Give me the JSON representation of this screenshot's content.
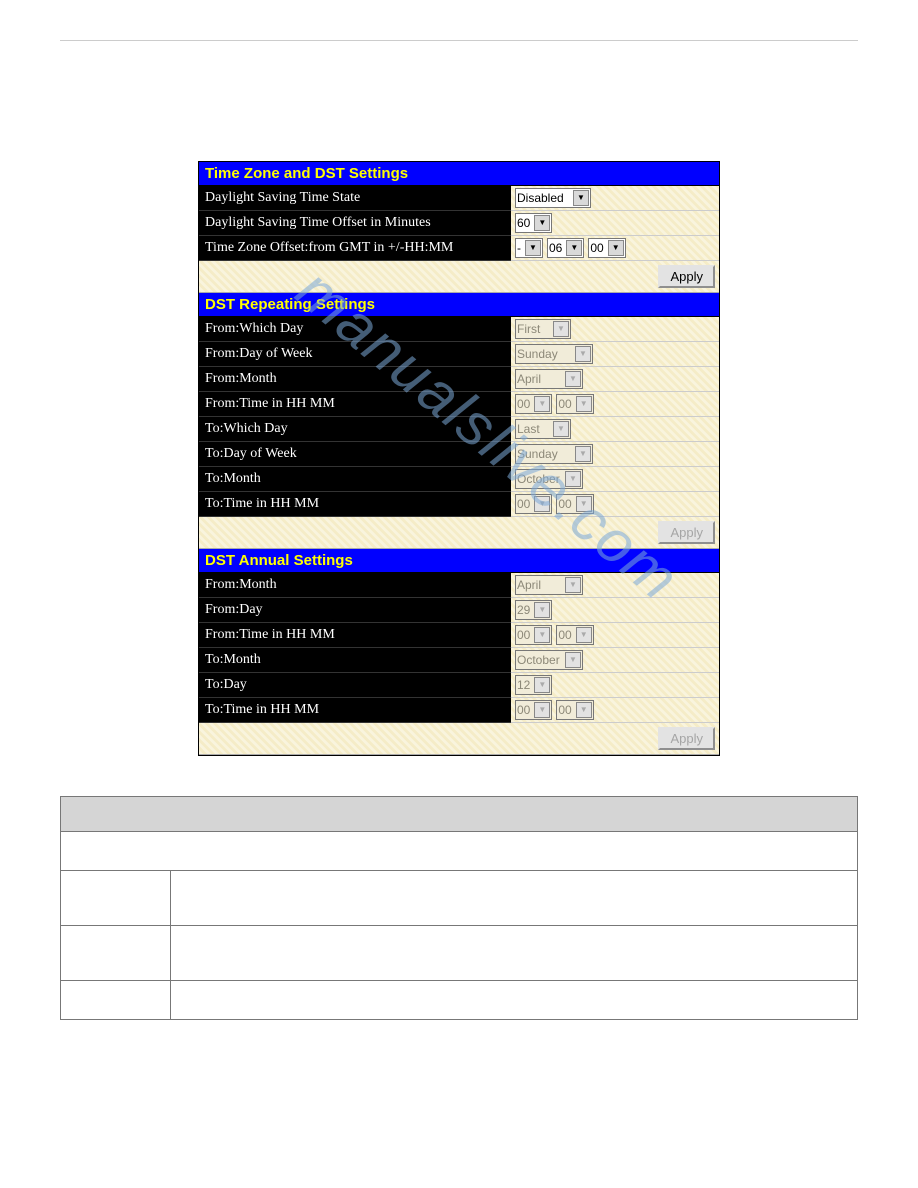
{
  "watermark": "manualslive.com",
  "sections": {
    "tz": "Time Zone and DST Settings",
    "repeating": "DST Repeating Settings",
    "annual": "DST Annual Settings"
  },
  "rows": {
    "dst_state": {
      "label": "Daylight Saving Time State",
      "value": "Disabled"
    },
    "dst_offset": {
      "label": "Daylight Saving Time Offset in Minutes",
      "value": "60"
    },
    "tz_offset": {
      "label": "Time Zone Offset:from GMT in +/-HH:MM",
      "sign": "-",
      "hh": "06",
      "mm": "00"
    },
    "rep_from_which": {
      "label": "From:Which Day",
      "value": "First"
    },
    "rep_from_dow": {
      "label": "From:Day of Week",
      "value": "Sunday"
    },
    "rep_from_month": {
      "label": "From:Month",
      "value": "April"
    },
    "rep_from_time": {
      "label": "From:Time in HH MM",
      "hh": "00",
      "mm": "00"
    },
    "rep_to_which": {
      "label": "To:Which Day",
      "value": "Last"
    },
    "rep_to_dow": {
      "label": "To:Day of Week",
      "value": "Sunday"
    },
    "rep_to_month": {
      "label": "To:Month",
      "value": "October"
    },
    "rep_to_time": {
      "label": "To:Time in HH MM",
      "hh": "00",
      "mm": "00"
    },
    "ann_from_month": {
      "label": "From:Month",
      "value": "April"
    },
    "ann_from_day": {
      "label": "From:Day",
      "value": "29"
    },
    "ann_from_time": {
      "label": "From:Time in HH MM",
      "hh": "00",
      "mm": "00"
    },
    "ann_to_month": {
      "label": "To:Month",
      "value": "October"
    },
    "ann_to_day": {
      "label": "To:Day",
      "value": "12"
    },
    "ann_to_time": {
      "label": "To:Time in HH MM",
      "hh": "00",
      "mm": "00"
    }
  },
  "buttons": {
    "apply": "Apply"
  }
}
